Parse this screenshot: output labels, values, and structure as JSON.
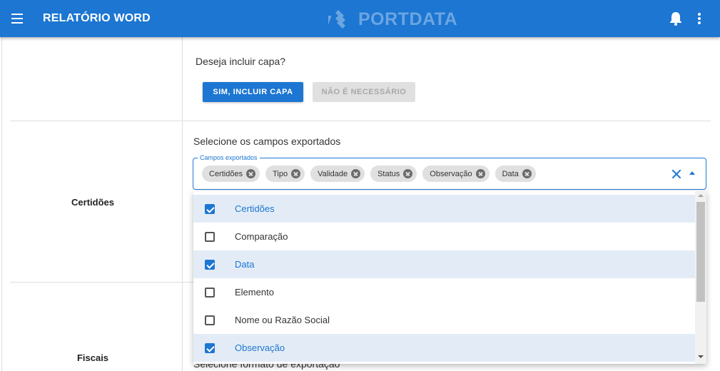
{
  "header": {
    "title": "RELATÓRIO WORD",
    "logo_text": "PORTDATA",
    "bar_color": "#1c76d2"
  },
  "table": {
    "rows": [
      {
        "label": ""
      },
      {
        "label": "Certidões"
      },
      {
        "label": "Fiscais"
      }
    ]
  },
  "cover": {
    "question": "Deseja incluir capa?",
    "yes_label": "SIM, INCLUIR CAPA",
    "no_label": "NÃO É NECESSÁRIO"
  },
  "fields": {
    "title": "Selecione os campos exportados",
    "legend": "Campos exportados",
    "chips": [
      "Certidões",
      "Tipo",
      "Validade",
      "Status",
      "Observação",
      "Data"
    ],
    "options": [
      {
        "label": "Certidões",
        "checked": true
      },
      {
        "label": "Comparação",
        "checked": false
      },
      {
        "label": "Data",
        "checked": true
      },
      {
        "label": "Elemento",
        "checked": false
      },
      {
        "label": "Nome ou Razão Social",
        "checked": false
      },
      {
        "label": "Observação",
        "checked": true
      }
    ]
  },
  "fiscais": {
    "format_title": "Selecione formato de exportação"
  },
  "icons": [
    "menu-icon",
    "bell-icon",
    "kebab-icon",
    "clear-icon",
    "caret-up-icon",
    "chip-remove-icon",
    "checkbox-icon"
  ]
}
